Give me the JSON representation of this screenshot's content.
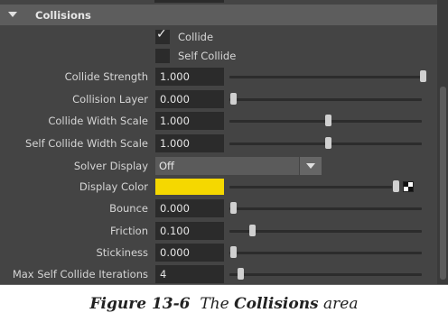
{
  "section": {
    "title": "Collisions"
  },
  "checkboxes": [
    {
      "label": "Collide",
      "checked": true
    },
    {
      "label": "Self Collide",
      "checked": false
    }
  ],
  "rows": {
    "collide_strength": {
      "label": "Collide Strength",
      "value": "1.000",
      "slider_fraction": 1.0
    },
    "collision_layer": {
      "label": "Collision Layer",
      "value": "0.000",
      "slider_fraction": 0.0
    },
    "collide_width_scale": {
      "label": "Collide Width Scale",
      "value": "1.000",
      "slider_fraction": 0.5
    },
    "self_collide_width_scale": {
      "label": "Self Collide Width Scale",
      "value": "1.000",
      "slider_fraction": 0.5
    },
    "solver_display": {
      "label": "Solver Display",
      "value": "Off"
    },
    "display_color": {
      "label": "Display Color",
      "color": "#f5d800",
      "slider_fraction": 1.0
    },
    "bounce": {
      "label": "Bounce",
      "value": "0.000",
      "slider_fraction": 0.0
    },
    "friction": {
      "label": "Friction",
      "value": "0.100",
      "slider_fraction": 0.1
    },
    "stickiness": {
      "label": "Stickiness",
      "value": "0.000",
      "slider_fraction": 0.0
    },
    "max_self_collide_iterations": {
      "label": "Max Self Collide Iterations",
      "value": "4",
      "slider_fraction": 0.04
    }
  },
  "caption": {
    "figure": "Figure 13-6",
    "text_before": "The",
    "emphasis": "Collisions",
    "text_after": "area"
  },
  "colors": {
    "panel_bg": "#444444",
    "header_bg": "#5d5d5d",
    "field_bg": "#2b2b2b",
    "display_color": "#f5d800"
  }
}
